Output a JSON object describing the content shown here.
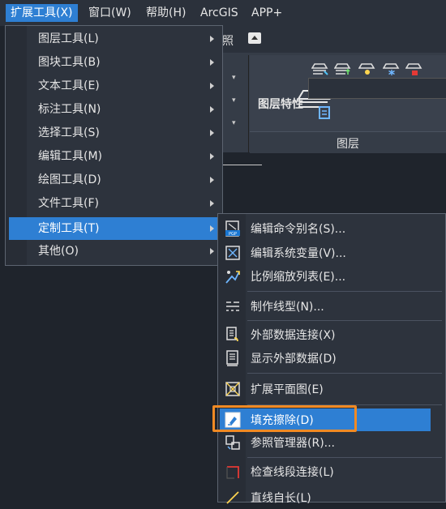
{
  "menubar": {
    "items": [
      {
        "label": "扩展工具(X)",
        "active": true
      },
      {
        "label": "窗口(W)"
      },
      {
        "label": "帮助(H)"
      },
      {
        "label": "ArcGIS"
      },
      {
        "label": "APP+"
      }
    ]
  },
  "ribbon": {
    "tab_glyph": "照",
    "big_button_label": "图层特性",
    "panel_label": "图层"
  },
  "main_menu": {
    "items": [
      {
        "label": "图层工具(L)",
        "has_submenu": true
      },
      {
        "label": "图块工具(B)",
        "has_submenu": true
      },
      {
        "label": "文本工具(E)",
        "has_submenu": true
      },
      {
        "label": "标注工具(N)",
        "has_submenu": true
      },
      {
        "label": "选择工具(S)",
        "has_submenu": true
      },
      {
        "label": "编辑工具(M)",
        "has_submenu": true
      },
      {
        "label": "绘图工具(D)",
        "has_submenu": true
      },
      {
        "label": "文件工具(F)",
        "has_submenu": true
      },
      {
        "label": "定制工具(T)",
        "has_submenu": true,
        "selected": true
      },
      {
        "label": "其他(O)",
        "has_submenu": true
      }
    ]
  },
  "sub_menu": {
    "items": [
      {
        "label": "编辑命令别名(S)...",
        "icon": "pgp-file-icon"
      },
      {
        "label": "编辑系统变量(V)...",
        "icon": "system-variable-icon"
      },
      {
        "label": "比例缩放列表(E)...",
        "icon": "scale-list-icon"
      },
      {
        "label": "制作线型(N)...",
        "icon": "linetype-icon"
      },
      {
        "label": "外部数据连接(X)",
        "icon": "data-link-icon"
      },
      {
        "label": "显示外部数据(D)",
        "icon": "show-data-icon"
      },
      {
        "label": "扩展平面图(E)",
        "icon": "expand-plan-icon"
      },
      {
        "label": "填充擦除(D)",
        "icon": "wipeout-icon",
        "highlighted": true
      },
      {
        "label": "参照管理器(R)...",
        "icon": "reference-manager-icon"
      },
      {
        "label": "检查线段连接(L)",
        "icon": "check-line-icon"
      },
      {
        "label": "直线自长(L)",
        "icon": "line-extend-icon"
      }
    ]
  },
  "colors": {
    "accent": "#2e7fd3",
    "highlight_box": "#f08a24",
    "menu_bg": "#2d333d",
    "app_bg": "#1f242c"
  }
}
